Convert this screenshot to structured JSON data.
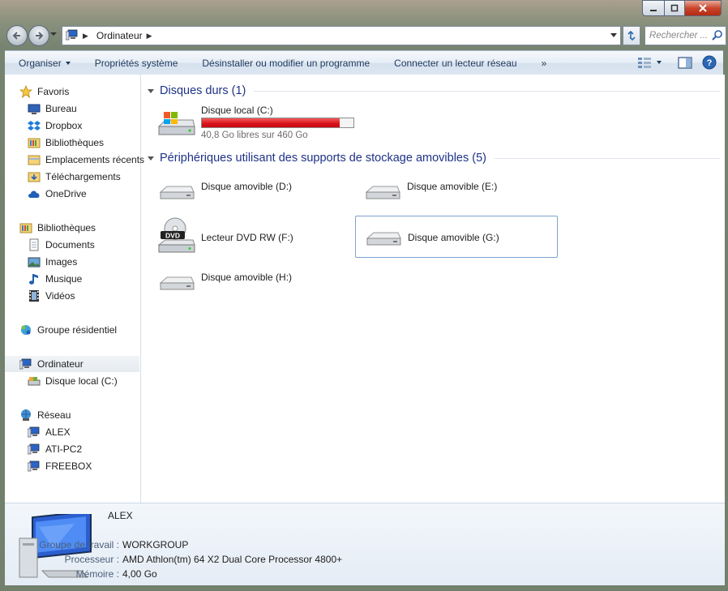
{
  "window": {
    "address": {
      "location": "Ordinateur"
    },
    "search": {
      "placeholder": "Rechercher ..."
    }
  },
  "toolbar": {
    "organize": "Organiser",
    "system_properties": "Propriétés système",
    "uninstall": "Désinstaller ou modifier un programme",
    "map_drive": "Connecter un lecteur réseau",
    "more": "»"
  },
  "nav": {
    "favorites": {
      "label": "Favoris",
      "items": [
        "Bureau",
        "Dropbox",
        "Bibliothèques",
        "Emplacements récents",
        "Téléchargements",
        "OneDrive"
      ]
    },
    "libraries": {
      "label": "Bibliothèques",
      "items": [
        "Documents",
        "Images",
        "Musique",
        "Vidéos"
      ]
    },
    "homegroup": {
      "label": "Groupe résidentiel"
    },
    "computer": {
      "label": "Ordinateur",
      "items": [
        "Disque local (C:)"
      ]
    },
    "network": {
      "label": "Réseau",
      "items": [
        "ALEX",
        "ATI-PC2",
        "FREEBOX"
      ]
    }
  },
  "groups": {
    "hard_disks": {
      "title": "Disques durs (1)",
      "drives": [
        {
          "name": "Disque local (C:)",
          "free_text": "40,8 Go libres sur 460 Go",
          "used_fraction": 0.911
        }
      ]
    },
    "removable": {
      "title": "Périphériques utilisant des supports de stockage amovibles (5)",
      "drives": [
        {
          "name": "Disque amovible (D:)"
        },
        {
          "name": "Disque amovible (E:)"
        },
        {
          "name": "Lecteur DVD RW (F:)",
          "dvd_label": "DVD"
        },
        {
          "name": "Disque amovible (G:)"
        },
        {
          "name": "Disque amovible (H:)"
        }
      ]
    }
  },
  "details": {
    "name": "ALEX",
    "workgroup_label": "Groupe de travail :",
    "workgroup_value": "WORKGROUP",
    "processor_label": "Processeur :",
    "processor_value": "AMD Athlon(tm) 64 X2 Dual Core Processor 4800+",
    "memory_label": "Mémoire :",
    "memory_value": "4,00 Go"
  },
  "colors": {
    "accent": "#1e3287",
    "drive_bar_fill": "#d8101a",
    "selection_border": "#7da2ce"
  }
}
